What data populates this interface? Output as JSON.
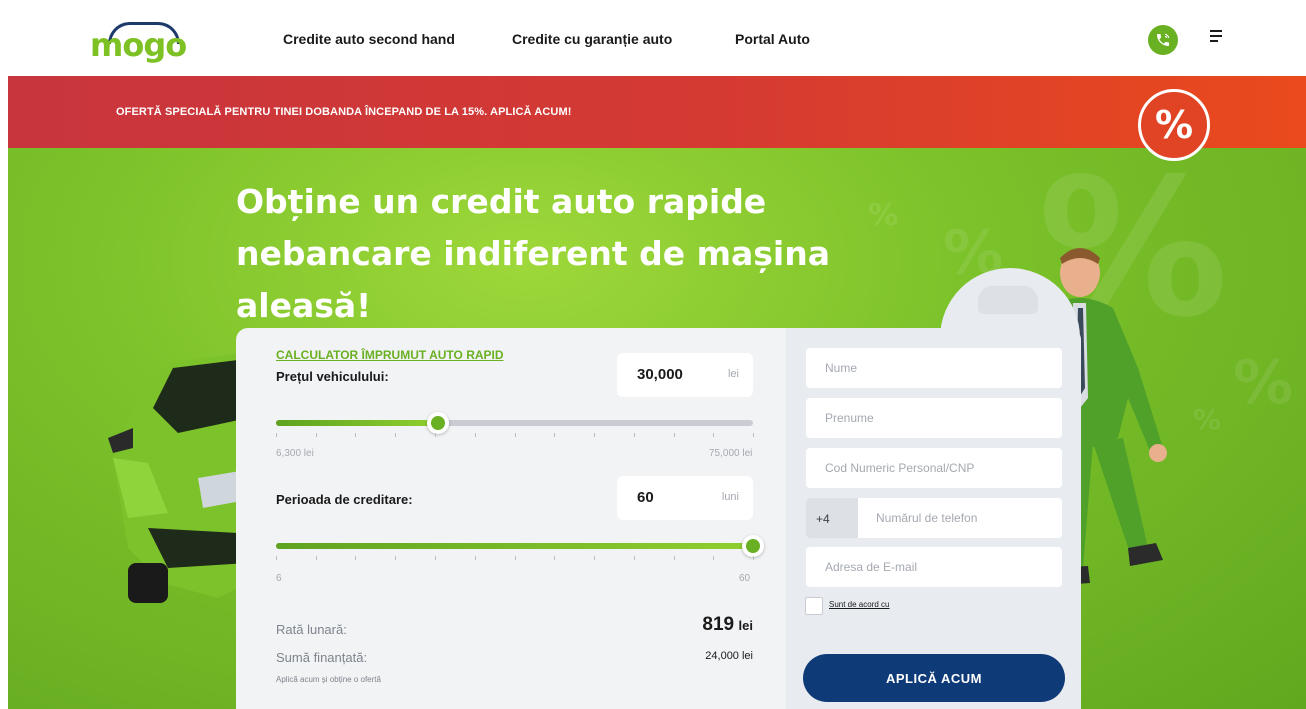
{
  "header": {
    "logo": "mogo",
    "nav": [
      {
        "label": "Credite auto second hand"
      },
      {
        "label": "Credite cu garanție auto"
      },
      {
        "label": "Portal Auto"
      }
    ],
    "icons": {
      "phone": "phone-icon",
      "menu": "menu-icon"
    }
  },
  "promo": {
    "text": "OFERTĂ SPECIALĂ PENTRU TINEI DOBANDA ÎNCEPAND DE LA 15%. APLICĂ ACUM!",
    "badge": "%"
  },
  "hero": {
    "title_lines": [
      "Obține un credit auto rapide",
      "nebancare indiferent de mașina",
      "aleasă!"
    ]
  },
  "calculator": {
    "title": "CALCULATOR ÎMPRUMUT AUTO RAPID",
    "price": {
      "label": "Prețul vehiculului:",
      "value": "30,000",
      "unit": "lei",
      "min": "6,300 lei",
      "max": "75,000 lei",
      "fraction": 0.34
    },
    "period": {
      "label": "Perioada de creditare:",
      "value": "60",
      "unit": "luni",
      "min": "6",
      "max": "60",
      "fraction": 1.0
    },
    "monthly": {
      "label": "Rată lunară:",
      "value": "819",
      "unit": "lei"
    },
    "financed": {
      "label": "Sumă finanțată:",
      "value": "24,000 lei"
    },
    "note": "Aplică acum și obține o ofertă"
  },
  "form": {
    "name_placeholder": "Nume",
    "surname_placeholder": "Prenume",
    "cnp_placeholder": "Cod Numeric Personal/CNP",
    "phone_prefix": "+4",
    "phone_placeholder": "Numărul de telefon",
    "email_placeholder": "Adresa de E-mail",
    "agree_label": "Sunt de acord cu",
    "apply_label": "APLICĂ ACUM"
  },
  "colors": {
    "brand_green": "#6ab023",
    "brand_navy": "#0f3a78",
    "promo_red": "#d53a32"
  }
}
